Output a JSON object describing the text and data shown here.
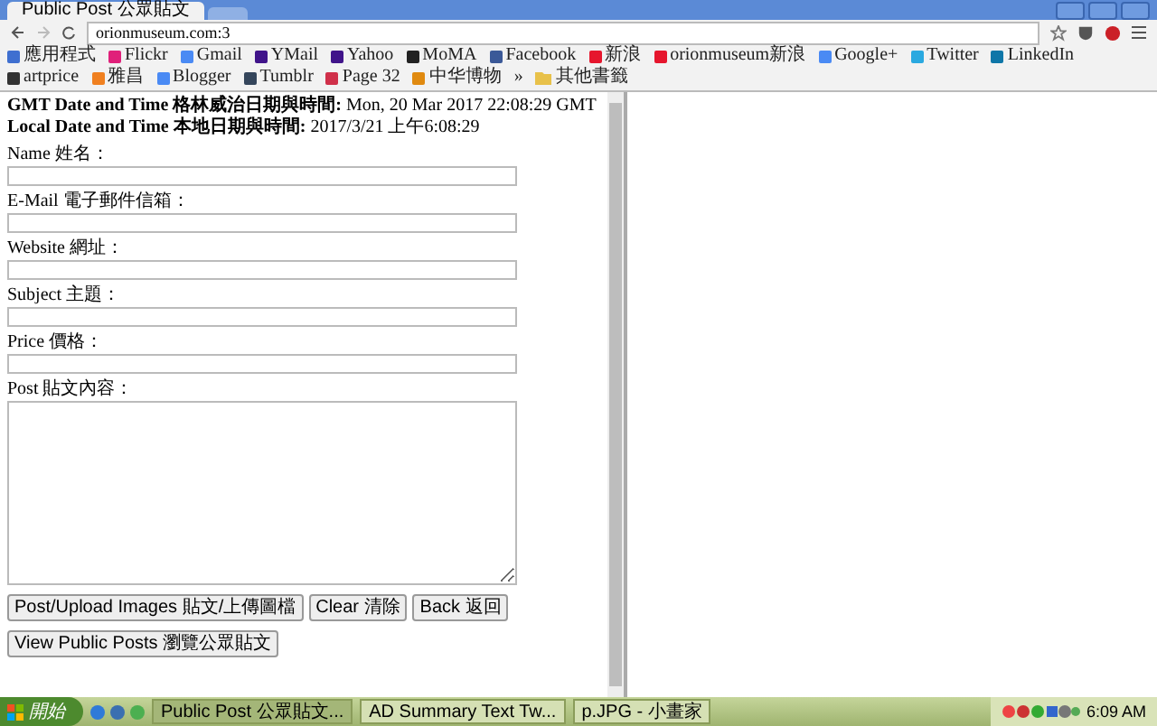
{
  "browser": {
    "tabs": [
      {
        "title": "Public Post 公眾貼文",
        "selected": true
      }
    ],
    "address": "orionmuseum.com:3",
    "bookmarks": [
      {
        "label": "應用程式",
        "color": "#3f6fd0"
      },
      {
        "label": "Flickr",
        "color": "#e0207a"
      },
      {
        "label": "Gmail",
        "color": "#4a8af4"
      },
      {
        "label": "YMail",
        "color": "#40148a"
      },
      {
        "label": "Yahoo",
        "color": "#40148a"
      },
      {
        "label": "MoMA",
        "color": "#222222"
      },
      {
        "label": "Facebook",
        "color": "#3b5998"
      },
      {
        "label": "新浪",
        "color": "#e6162d"
      },
      {
        "label": "orionmuseum新浪",
        "color": "#e6162d"
      },
      {
        "label": "Google+",
        "color": "#4a8af4"
      },
      {
        "label": "Twitter",
        "color": "#2aa9e0"
      },
      {
        "label": "LinkedIn",
        "color": "#0e76a8"
      },
      {
        "label": "artprice",
        "color": "#333333"
      },
      {
        "label": "雅昌",
        "color": "#f08020"
      },
      {
        "label": "Blogger",
        "color": "#4a8af4"
      },
      {
        "label": "Tumblr",
        "color": "#35465c"
      },
      {
        "label": "Page 32",
        "color": "#d0304a"
      },
      {
        "label": "中华博物",
        "color": "#e08a10"
      }
    ],
    "more": "»",
    "other_bookmarks": "其他書籤"
  },
  "page": {
    "gmt_label": "GMT Date and Time 格林威治日期與時間:",
    "gmt_value": "Mon, 20 Mar 2017 22:08:29 GMT",
    "local_label": "Local Date and Time 本地日期與時間:",
    "local_value": "2017/3/21 上午6:08:29",
    "fields": [
      {
        "label": "Name 姓名："
      },
      {
        "label": "E-Mail 電子郵件信箱："
      },
      {
        "label": "Website 網址："
      },
      {
        "label": "Subject 主題："
      },
      {
        "label": "Price 價格："
      }
    ],
    "post_label": "Post 貼文內容：",
    "buttons": [
      "Post/Upload Images 貼文/上傳圖檔",
      "Clear 清除",
      "Back 返回"
    ],
    "view_button": "View Public Posts 瀏覽公眾貼文"
  },
  "taskbar": {
    "start": "開始",
    "windows": [
      {
        "title": "Public Post 公眾貼文...",
        "selected": true
      },
      {
        "title": "AD Summary Text Tw...",
        "selected": false
      },
      {
        "title": "p.JPG - 小畫家",
        "selected": false
      }
    ],
    "clock": "6:09 AM"
  }
}
